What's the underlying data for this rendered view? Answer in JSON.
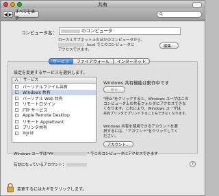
{
  "window": {
    "title": "共有"
  },
  "toolbar": {
    "back": "◀",
    "forward": "▶",
    "show_all": "すべてを表示",
    "search_placeholder": ""
  },
  "computer_name": {
    "label": "コンピュータ名：",
    "value_suffix": "のコンピュータ"
  },
  "local_note": {
    "line1": "ローカルサブネット上のほかのコンピュータから、",
    "line2_suffix": ".local でこのコンピュータに",
    "line3": "アクセスできます。",
    "edit_button": "編集..."
  },
  "tabs": [
    {
      "label": "サービス"
    },
    {
      "label": "ファイアウォール"
    },
    {
      "label": "インターネット"
    }
  ],
  "services": {
    "prompt": "設定を変更するサービスを選択します。",
    "header_on": "入",
    "header_service": "サービス",
    "items": [
      {
        "label": "パーソナルファイル共有",
        "checked": ""
      },
      {
        "label": "Windows 共有",
        "checked": "✓"
      },
      {
        "label": "パーソナル Web 共有",
        "checked": ""
      },
      {
        "label": "リモートログイン",
        "checked": ""
      },
      {
        "label": "FTP サービス",
        "checked": ""
      },
      {
        "label": "Apple Remote Desktop",
        "checked": ""
      },
      {
        "label": "リモート AppleEvent",
        "checked": ""
      },
      {
        "label": "プリンタ共有",
        "checked": ""
      },
      {
        "label": "Xgrid",
        "checked": ""
      }
    ]
  },
  "detail": {
    "status": "Windows 共有機能は動作中です",
    "stop_button": "停止",
    "desc1_l1": "\"停止\"をクリックすると、Windows ユーザはこの",
    "desc1_l2": "コンピュータ上の共有フォルダにアクセスできな",
    "desc1_l3": "くなります。これにより、Windows ユーザは",
    "desc1_l4": "共有プリンタでプリントすることもできなくなります。",
    "desc2_l1": "Windows 共有を使用できるアカウントを選",
    "desc2_l2": "択するには、\"アカウント\"をクリックしてく",
    "desc2_l3": "ださい。",
    "accounts_button": "アカウント..."
  },
  "footer": {
    "access_prefix": "Windows ユーザは\"¥¥",
    "access_suffix": "\" でこのコンピュータにアクセスできます",
    "enabled_accounts": "有効になっているアカウント：",
    "help": "?",
    "lock_text": "変更するにはカギをクリックします。"
  }
}
